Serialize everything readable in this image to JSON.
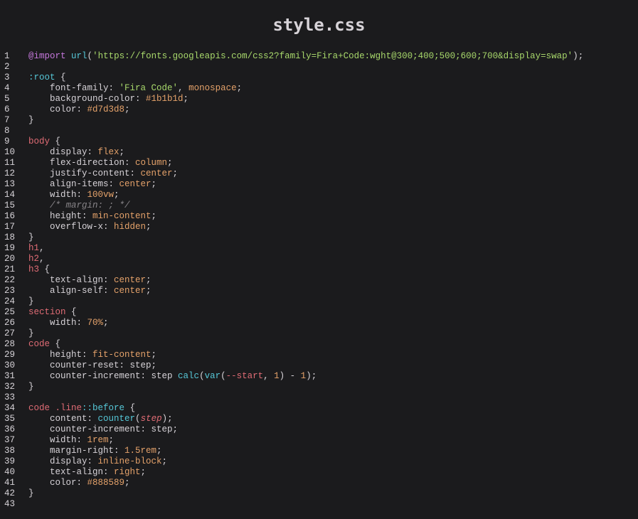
{
  "title": "style.css",
  "colors": {
    "background": "#1b1b1d",
    "text": "#d7d3d8",
    "at_rule": "#c678dd",
    "function": "#56c8d8",
    "string": "#a8d86b",
    "selector": "#e06c75",
    "value": "#e5a26a",
    "comment": "#888589"
  },
  "lines": [
    {
      "n": "1",
      "tokens": [
        [
          "at",
          "@import"
        ],
        [
          "p",
          " "
        ],
        [
          "fn",
          "url"
        ],
        [
          "p",
          "("
        ],
        [
          "str",
          "'https://fonts.googleapis.com/css2?family=Fira+Code:wght@300;400;500;600;700&display=swap'"
        ],
        [
          "p",
          ");"
        ]
      ]
    },
    {
      "n": "2",
      "tokens": []
    },
    {
      "n": "3",
      "tokens": [
        [
          "psel",
          ":root"
        ],
        [
          "p",
          " {"
        ]
      ]
    },
    {
      "n": "4",
      "tokens": [
        [
          "p",
          "    font-family: "
        ],
        [
          "str",
          "'Fira Code'"
        ],
        [
          "p",
          ", "
        ],
        [
          "val",
          "monospace"
        ],
        [
          "p",
          ";"
        ]
      ]
    },
    {
      "n": "5",
      "tokens": [
        [
          "p",
          "    background-color: "
        ],
        [
          "hex",
          "#1b1b1d"
        ],
        [
          "p",
          ";"
        ]
      ]
    },
    {
      "n": "6",
      "tokens": [
        [
          "p",
          "    color: "
        ],
        [
          "hex",
          "#d7d3d8"
        ],
        [
          "p",
          ";"
        ]
      ]
    },
    {
      "n": "7",
      "tokens": [
        [
          "p",
          "}"
        ]
      ]
    },
    {
      "n": "8",
      "tokens": []
    },
    {
      "n": "9",
      "tokens": [
        [
          "sel",
          "body"
        ],
        [
          "p",
          " {"
        ]
      ]
    },
    {
      "n": "10",
      "tokens": [
        [
          "p",
          "    display: "
        ],
        [
          "val",
          "flex"
        ],
        [
          "p",
          ";"
        ]
      ]
    },
    {
      "n": "11",
      "tokens": [
        [
          "p",
          "    flex-direction: "
        ],
        [
          "val",
          "column"
        ],
        [
          "p",
          ";"
        ]
      ]
    },
    {
      "n": "12",
      "tokens": [
        [
          "p",
          "    justify-content: "
        ],
        [
          "val",
          "center"
        ],
        [
          "p",
          ";"
        ]
      ]
    },
    {
      "n": "13",
      "tokens": [
        [
          "p",
          "    align-items: "
        ],
        [
          "val",
          "center"
        ],
        [
          "p",
          ";"
        ]
      ]
    },
    {
      "n": "14",
      "tokens": [
        [
          "p",
          "    width: "
        ],
        [
          "num",
          "100vw"
        ],
        [
          "p",
          ";"
        ]
      ]
    },
    {
      "n": "15",
      "tokens": [
        [
          "com",
          "    /* margin: ; */"
        ]
      ]
    },
    {
      "n": "16",
      "tokens": [
        [
          "p",
          "    height: "
        ],
        [
          "val",
          "min-content"
        ],
        [
          "p",
          ";"
        ]
      ]
    },
    {
      "n": "17",
      "tokens": [
        [
          "p",
          "    overflow-x: "
        ],
        [
          "val",
          "hidden"
        ],
        [
          "p",
          ";"
        ]
      ]
    },
    {
      "n": "18",
      "tokens": [
        [
          "p",
          "}"
        ]
      ]
    },
    {
      "n": "19",
      "tokens": [
        [
          "sel",
          "h1"
        ],
        [
          "p",
          ","
        ]
      ]
    },
    {
      "n": "20",
      "tokens": [
        [
          "sel",
          "h2"
        ],
        [
          "p",
          ","
        ]
      ]
    },
    {
      "n": "21",
      "tokens": [
        [
          "sel",
          "h3"
        ],
        [
          "p",
          " {"
        ]
      ]
    },
    {
      "n": "22",
      "tokens": [
        [
          "p",
          "    text-align: "
        ],
        [
          "val",
          "center"
        ],
        [
          "p",
          ";"
        ]
      ]
    },
    {
      "n": "23",
      "tokens": [
        [
          "p",
          "    align-self: "
        ],
        [
          "val",
          "center"
        ],
        [
          "p",
          ";"
        ]
      ]
    },
    {
      "n": "24",
      "tokens": [
        [
          "p",
          "}"
        ]
      ]
    },
    {
      "n": "25",
      "tokens": [
        [
          "sel",
          "section"
        ],
        [
          "p",
          " {"
        ]
      ]
    },
    {
      "n": "26",
      "tokens": [
        [
          "p",
          "    width: "
        ],
        [
          "num",
          "70%"
        ],
        [
          "p",
          ";"
        ]
      ]
    },
    {
      "n": "27",
      "tokens": [
        [
          "p",
          "}"
        ]
      ]
    },
    {
      "n": "28",
      "tokens": [
        [
          "sel",
          "code"
        ],
        [
          "p",
          " {"
        ]
      ]
    },
    {
      "n": "29",
      "tokens": [
        [
          "p",
          "    height: "
        ],
        [
          "val",
          "fit-content"
        ],
        [
          "p",
          ";"
        ]
      ]
    },
    {
      "n": "30",
      "tokens": [
        [
          "p",
          "    counter-reset: step;"
        ]
      ]
    },
    {
      "n": "31",
      "tokens": [
        [
          "p",
          "    counter-increment: step "
        ],
        [
          "fn",
          "calc"
        ],
        [
          "p",
          "("
        ],
        [
          "fn",
          "var"
        ],
        [
          "p",
          "("
        ],
        [
          "cust",
          "--start"
        ],
        [
          "p",
          ", "
        ],
        [
          "num",
          "1"
        ],
        [
          "p",
          ") - "
        ],
        [
          "num",
          "1"
        ],
        [
          "p",
          ");"
        ]
      ]
    },
    {
      "n": "32",
      "tokens": [
        [
          "p",
          "}"
        ]
      ]
    },
    {
      "n": "33",
      "tokens": []
    },
    {
      "n": "34",
      "tokens": [
        [
          "sel",
          "code"
        ],
        [
          "p",
          " "
        ],
        [
          "sel",
          ".line"
        ],
        [
          "psel",
          "::before"
        ],
        [
          "p",
          " {"
        ]
      ]
    },
    {
      "n": "35",
      "tokens": [
        [
          "p",
          "    content: "
        ],
        [
          "fn",
          "counter"
        ],
        [
          "p",
          "("
        ],
        [
          "var",
          "step"
        ],
        [
          "p",
          ");"
        ]
      ]
    },
    {
      "n": "36",
      "tokens": [
        [
          "p",
          "    counter-increment: step;"
        ]
      ]
    },
    {
      "n": "37",
      "tokens": [
        [
          "p",
          "    width: "
        ],
        [
          "num",
          "1rem"
        ],
        [
          "p",
          ";"
        ]
      ]
    },
    {
      "n": "38",
      "tokens": [
        [
          "p",
          "    margin-right: "
        ],
        [
          "num",
          "1.5rem"
        ],
        [
          "p",
          ";"
        ]
      ]
    },
    {
      "n": "39",
      "tokens": [
        [
          "p",
          "    display: "
        ],
        [
          "val",
          "inline-block"
        ],
        [
          "p",
          ";"
        ]
      ]
    },
    {
      "n": "40",
      "tokens": [
        [
          "p",
          "    text-align: "
        ],
        [
          "val",
          "right"
        ],
        [
          "p",
          ";"
        ]
      ]
    },
    {
      "n": "41",
      "tokens": [
        [
          "p",
          "    color: "
        ],
        [
          "hex",
          "#888589"
        ],
        [
          "p",
          ";"
        ]
      ]
    },
    {
      "n": "42",
      "tokens": [
        [
          "p",
          "}"
        ]
      ]
    },
    {
      "n": "43",
      "tokens": []
    }
  ]
}
